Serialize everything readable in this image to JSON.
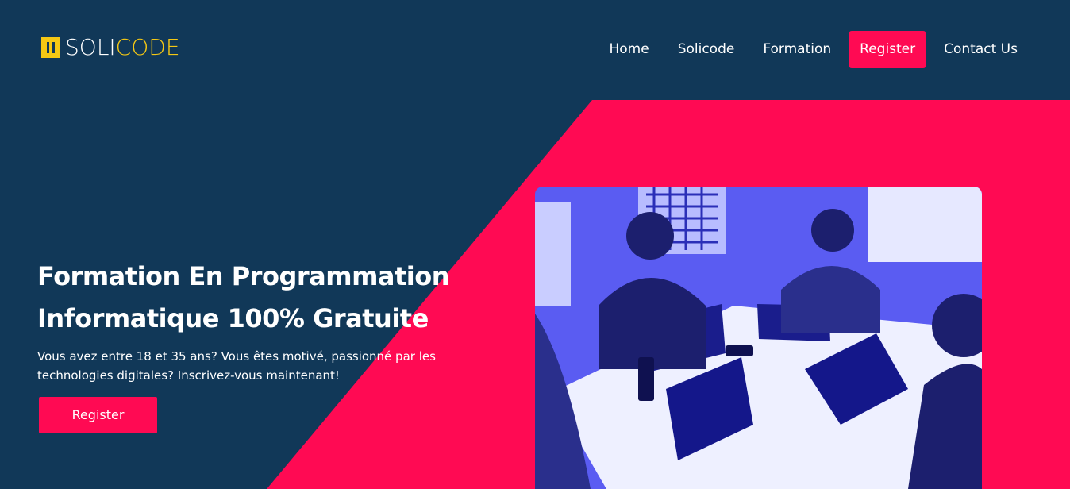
{
  "brand": {
    "logo_part1": "SOLI",
    "logo_part2": "CODE",
    "primary_color": "#113858",
    "accent_color": "#ff0a53",
    "logo_color": "#f5c814"
  },
  "nav": {
    "items": [
      {
        "label": "Home",
        "active": false
      },
      {
        "label": "Solicode",
        "active": false
      },
      {
        "label": "Formation",
        "active": false
      },
      {
        "label": "Register",
        "active": true
      },
      {
        "label": "Contact Us",
        "active": false
      }
    ]
  },
  "hero": {
    "title_line1": "Formation En Programmation",
    "title_line2": "Informatique 100% Gratuite",
    "subtitle": "Vous avez entre 18 et 35 ans? Vous êtes motivé, passionné par les technologies digitales? Inscrivez-vous maintenant!",
    "button_label": "Register"
  }
}
